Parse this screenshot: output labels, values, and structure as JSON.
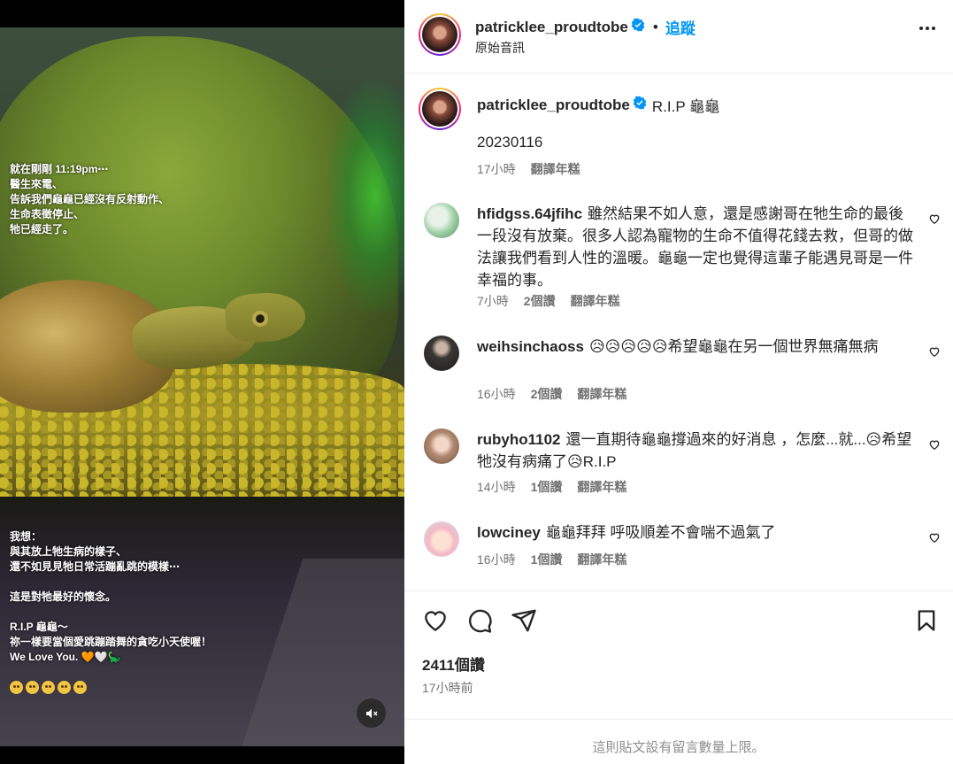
{
  "media": {
    "overlay_top": "就在剛剛 11:19pm⋯\n醫生來電、\n告訴我們龜龜已經沒有反射動作、\n生命表徵停止、\n牠已經走了。",
    "overlay_bottom": "我想：\n與其放上牠生病的樣子、\n還不如見見牠日常活蹦亂跳的模樣⋯\n\n這是對牠最好的懷念。\n\nR.I.P 龜龜～\n祢一樣要當個愛跳蹦踏舞的貪吃小天使喔！\nWe Love You. 🧡🤍🦕",
    "emoji_icons": [
      "pleading-face-icon",
      "pleading-face-icon",
      "pleading-face-icon",
      "pleading-face-icon",
      "pleading-face-icon"
    ]
  },
  "header": {
    "username": "patricklee_proudtobe",
    "separator": "•",
    "follow_label": "追蹤",
    "subtitle": "原始音訊"
  },
  "caption": {
    "username": "patricklee_proudtobe",
    "text": "R.I.P 龜龜",
    "date": "20230116",
    "time": "17小時",
    "translate": "翻譯年糕"
  },
  "comments": [
    {
      "username": "hfidgss.64jfihc",
      "text": "雖然結果不如人意，還是感謝哥在牠生命的最後一段沒有放棄。很多人認為寵物的生命不值得花錢去救，但哥的做法讓我們看到人性的溫暖。龜龜一定也覺得這輩子能遇見哥是一件幸福的事。",
      "time": "7小時",
      "likes": "2個讚",
      "translate": "翻譯年糕"
    },
    {
      "username": "weihsinchaoss",
      "text": "😥😥😥😥😥希望龜龜在另一個世界無痛無病",
      "time": "16小時",
      "likes": "2個讚",
      "translate": "翻譯年糕"
    },
    {
      "username": "rubyho1102",
      "text": "還一直期待龜龜撐過來的好消息 ，怎麼...就...😥希望牠沒有病痛了😥R.I.P",
      "time": "14小時",
      "likes": "1個讚",
      "translate": "翻譯年糕"
    },
    {
      "username": "lowciney",
      "text": "龜龜拜拜 呼吸順差不會喘不過氣了",
      "time": "16小時",
      "likes": "1個讚",
      "translate": "翻譯年糕"
    }
  ],
  "post": {
    "likes": "2411個讚",
    "time_ago": "17小時前",
    "footer_note": "這則貼文設有留言數量上限。"
  },
  "colors": {
    "accent": "#0095f6",
    "verified": "#0095f6",
    "muted_text": "#737373"
  }
}
